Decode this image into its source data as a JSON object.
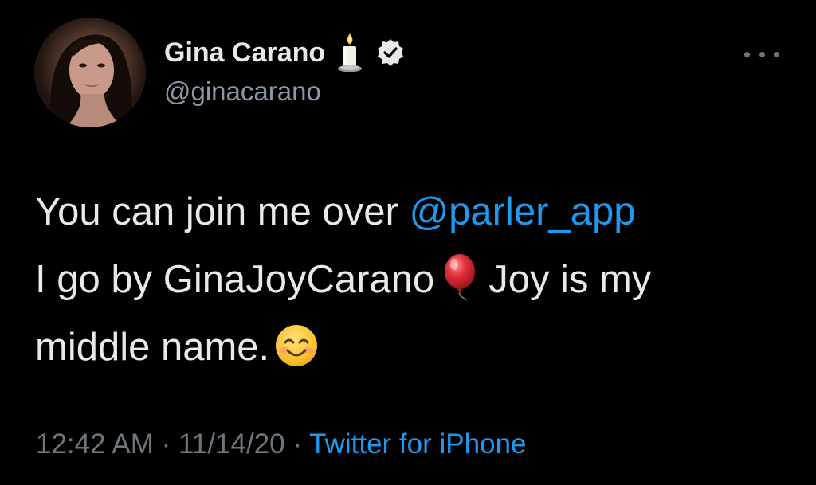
{
  "tweet": {
    "author": {
      "display_name": "Gina Carano",
      "handle": "@ginacarano",
      "avatar_alt": "profile photo",
      "badges": [
        "candle-icon",
        "verified-icon"
      ]
    },
    "text": {
      "line1_prefix": "You can join me over ",
      "line1_mention": "@parler_app",
      "line2_prefix": "I go by GinaJoyCarano",
      "line2_suffix": "Joy is my",
      "line3_prefix": "middle name."
    },
    "meta": {
      "time": "12:42 AM",
      "sep1": " · ",
      "date": "11/14/20",
      "sep2": " · ",
      "source": "Twitter for iPhone"
    }
  },
  "colors": {
    "background": "#000000",
    "text_primary": "#e7e9ea",
    "text_secondary": "#8b98a5",
    "link": "#1d9bf0",
    "meta": "#6e767d"
  }
}
